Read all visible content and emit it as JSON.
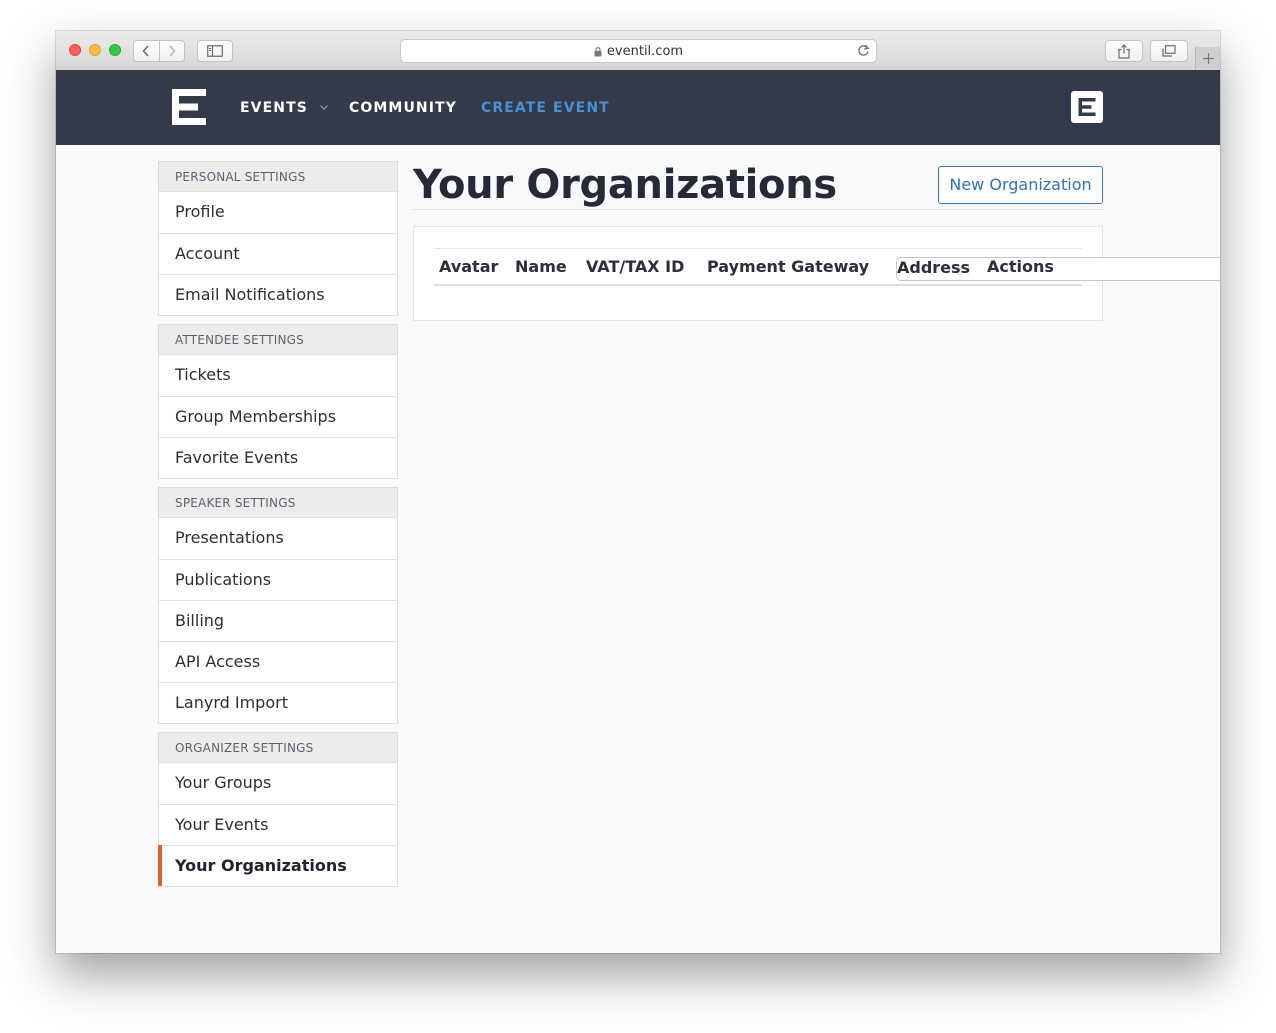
{
  "browser": {
    "url": "eventil.com"
  },
  "header": {
    "nav": {
      "events": "EVENTS",
      "community": "COMMUNITY",
      "create_event": "CREATE EVENT"
    },
    "accent_color": "#4a8fd1"
  },
  "sidebar": {
    "personal": {
      "heading": "PERSONAL SETTINGS",
      "items": [
        "Profile",
        "Account",
        "Email Notifications"
      ]
    },
    "attendee": {
      "heading": "ATTENDEE SETTINGS",
      "items": [
        "Tickets",
        "Group Memberships",
        "Favorite Events"
      ]
    },
    "speaker": {
      "heading": "SPEAKER SETTINGS",
      "items": [
        "Presentations",
        "Publications",
        "Billing",
        "API Access",
        "Lanyrd Import"
      ]
    },
    "organizer": {
      "heading": "ORGANIZER SETTINGS",
      "items": [
        "Your Groups",
        "Your Events",
        "Your Organizations"
      ],
      "active": "Your Organizations"
    },
    "active_indicator_color": "#e0602a"
  },
  "main": {
    "title": "Your Organizations",
    "new_button": "New Organization",
    "table": {
      "columns": [
        "Avatar",
        "Name",
        "VAT/TAX ID",
        "Payment Gateway",
        "Address",
        "Actions"
      ],
      "rows": []
    }
  }
}
